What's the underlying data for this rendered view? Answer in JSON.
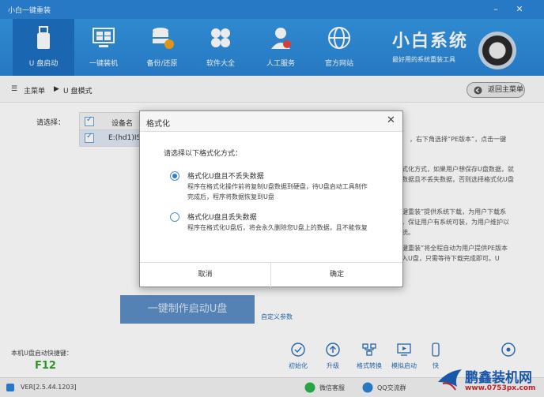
{
  "app": {
    "title": "小白一键重装"
  },
  "toolbar": {
    "tabs": [
      {
        "label": "U 盘启动",
        "icon": "usb-icon"
      },
      {
        "label": "一键装机",
        "icon": "monitor-icon"
      },
      {
        "label": "备份/还原",
        "icon": "database-icon"
      },
      {
        "label": "软件大全",
        "icon": "apps-icon"
      },
      {
        "label": "人工服务",
        "icon": "support-icon"
      },
      {
        "label": "官方网站",
        "icon": "globe-icon"
      }
    ]
  },
  "brand": {
    "name": "小白系统",
    "slogan": "最好用的系统重装工具"
  },
  "breadcrumb": {
    "root": "主菜单",
    "current": "U 盘模式",
    "back": "返回主菜单"
  },
  "device": {
    "select_label": "请选择：",
    "column_name": "设备名",
    "row_value": "E:(hd1)IS"
  },
  "info": {
    "lines": [
      "，右下角选择“PE版本”，点击一键",
      "式化方式，如果用户想保存U盘数据，就",
      "数据且不丢失数据，否则选择格式化U盘",
      "键重装”提供系统下载，为用户下载系",
      "，保证用户有系统可装，为用户维护以",
      "统。",
      "键重装”将全程自动为用户提供PE版本",
      "入U盘，只需等待下载完成即可。U"
    ]
  },
  "main": {
    "make_button": "一键制作启动U盘",
    "custom_params": "自定义参数"
  },
  "hotkey": {
    "label": "本机U盘启动快捷键：",
    "key": "F12"
  },
  "actions": [
    {
      "label": "初始化",
      "icon": "refresh-icon"
    },
    {
      "label": "升级",
      "icon": "upgrade-icon"
    },
    {
      "label": "格式转换",
      "icon": "convert-icon"
    },
    {
      "label": "模拟启动",
      "icon": "simulate-icon"
    },
    {
      "label": "快",
      "icon": "shortcut-icon"
    },
    {
      "label": "",
      "icon": "more-icon"
    }
  ],
  "statusbar": {
    "version": "VER[2.5.44.1203]",
    "wechat": "微信客服",
    "qq": "QQ交流群"
  },
  "watermark": {
    "name": "鹏鑫装机网",
    "url": "www.0753px.com"
  },
  "dialog": {
    "title": "格式化",
    "prompt": "请选择以下格式化方式：",
    "options": [
      {
        "title": "格式化U盘且不丢失数据",
        "desc_line1": "程序在格式化操作前将复制U盘数据到硬盘，待U盘启动工具制作",
        "desc_line2": "完成后，程序将数据恢复到U盘",
        "checked": true
      },
      {
        "title": "格式化U盘且丢失数据",
        "desc_line1": "程序在格式化U盘后，将会永久删除您U盘上的数据，且不能恢复",
        "checked": false
      }
    ],
    "cancel": "取消",
    "ok": "确定"
  },
  "colors": {
    "accent": "#2b84d6",
    "hotkey": "#36a12c",
    "button_disabled": "#5c8ec4"
  }
}
